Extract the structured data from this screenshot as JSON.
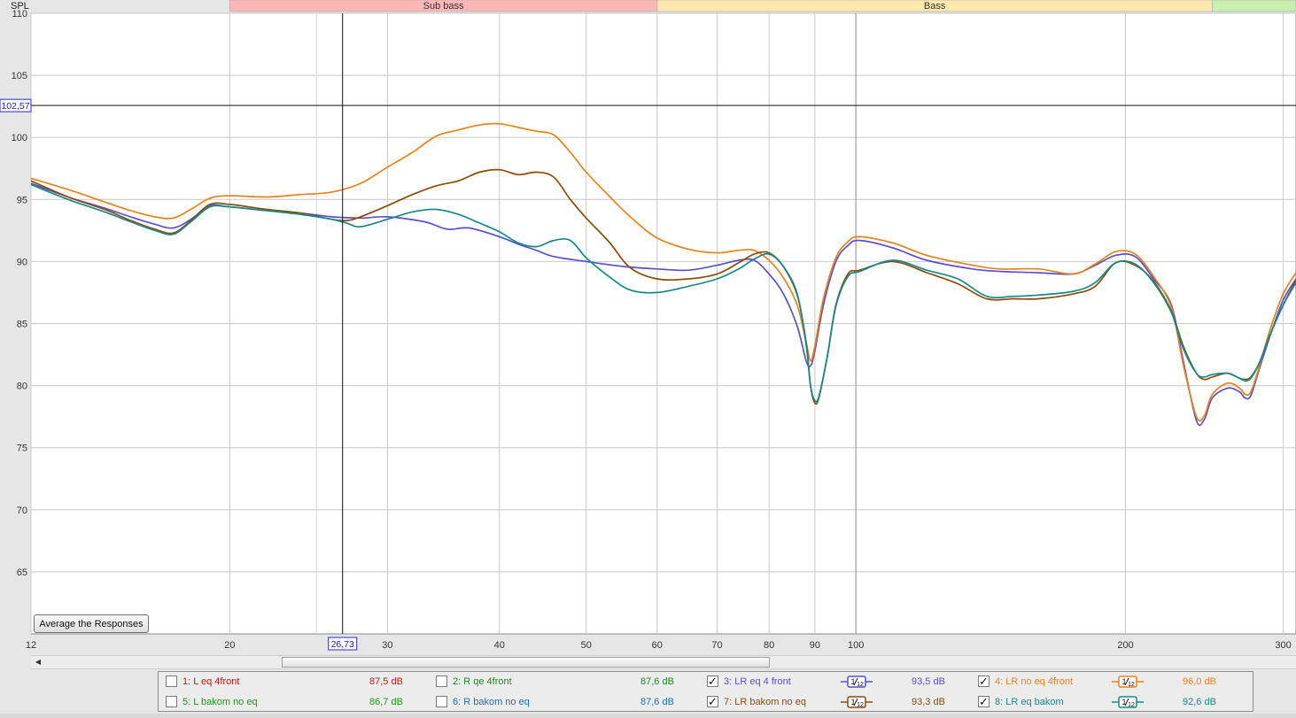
{
  "chart_data": {
    "type": "line",
    "ylabel": "SPL",
    "xscale": "log",
    "xlim": [
      12,
      310
    ],
    "ylim": [
      60,
      110
    ],
    "yticks": [
      65,
      70,
      75,
      80,
      85,
      90,
      95,
      100,
      105,
      110
    ],
    "xticks": [
      12,
      20,
      30,
      40,
      50,
      60,
      70,
      80,
      90,
      100,
      200,
      300
    ],
    "minor_xticks": [
      25
    ],
    "bands": [
      {
        "label": "Sub bass",
        "from": 20,
        "to": 60,
        "color": "#ffb6b6"
      },
      {
        "label": "Bass",
        "from": 60,
        "to": 250,
        "color": "#ffe8ad"
      },
      {
        "label": "",
        "from": 250,
        "to": 310,
        "color": "#c8eeb0"
      }
    ],
    "cursor": {
      "x_label": "26,73",
      "y_label": "102,57",
      "x": 26.73,
      "y": 102.57
    },
    "series": [
      {
        "name": "3: LR eq 4 front",
        "color": "#5a4fd0",
        "points": [
          [
            12,
            96.3
          ],
          [
            13.2,
            95.2
          ],
          [
            14.5,
            94.3
          ],
          [
            15.5,
            93.6
          ],
          [
            16.5,
            93.0
          ],
          [
            17.3,
            92.7
          ],
          [
            18.1,
            93.4
          ],
          [
            19.0,
            94.5
          ],
          [
            20,
            94.4
          ],
          [
            22,
            94.1
          ],
          [
            24,
            93.9
          ],
          [
            26,
            93.6
          ],
          [
            28,
            93.5
          ],
          [
            30,
            93.6
          ],
          [
            33,
            93.2
          ],
          [
            35,
            92.6
          ],
          [
            37,
            92.7
          ],
          [
            40,
            92.0
          ],
          [
            42,
            91.4
          ],
          [
            44,
            90.9
          ],
          [
            46,
            90.4
          ],
          [
            50,
            90.0
          ],
          [
            55,
            89.6
          ],
          [
            60,
            89.4
          ],
          [
            65,
            89.3
          ],
          [
            70,
            89.7
          ],
          [
            74,
            90.1
          ],
          [
            77,
            90.1
          ],
          [
            80,
            89.0
          ],
          [
            83,
            87.4
          ],
          [
            86,
            84.8
          ],
          [
            88,
            82.0
          ],
          [
            89,
            81.6
          ],
          [
            90,
            82.8
          ],
          [
            92,
            86.5
          ],
          [
            95,
            90.0
          ],
          [
            98,
            91.3
          ],
          [
            101,
            91.7
          ],
          [
            110,
            91.1
          ],
          [
            120,
            90.1
          ],
          [
            135,
            89.4
          ],
          [
            145,
            89.2
          ],
          [
            160,
            89.1
          ],
          [
            175,
            89.0
          ],
          [
            185,
            89.7
          ],
          [
            195,
            90.5
          ],
          [
            205,
            90.4
          ],
          [
            215,
            88.6
          ],
          [
            225,
            86.5
          ],
          [
            232,
            82.0
          ],
          [
            240,
            77.2
          ],
          [
            245,
            77.3
          ],
          [
            250,
            79.0
          ],
          [
            260,
            79.8
          ],
          [
            268,
            79.5
          ],
          [
            272,
            79.0
          ],
          [
            276,
            79.2
          ],
          [
            282,
            81.3
          ],
          [
            290,
            84.0
          ],
          [
            300,
            86.9
          ],
          [
            310,
            88.6
          ]
        ]
      },
      {
        "name": "4: LR no eq 4front",
        "color": "#e8821c",
        "points": [
          [
            12,
            96.7
          ],
          [
            13.2,
            95.8
          ],
          [
            14.5,
            94.8
          ],
          [
            15.5,
            94.1
          ],
          [
            16.5,
            93.6
          ],
          [
            17.3,
            93.5
          ],
          [
            18.1,
            94.2
          ],
          [
            19.0,
            95.1
          ],
          [
            20,
            95.3
          ],
          [
            22,
            95.2
          ],
          [
            24,
            95.4
          ],
          [
            26,
            95.6
          ],
          [
            28,
            96.3
          ],
          [
            30,
            97.6
          ],
          [
            32,
            98.8
          ],
          [
            34,
            100.1
          ],
          [
            36,
            100.6
          ],
          [
            38,
            101.0
          ],
          [
            40,
            101.1
          ],
          [
            42,
            100.8
          ],
          [
            44,
            100.5
          ],
          [
            46,
            100.2
          ],
          [
            48,
            98.8
          ],
          [
            50,
            97.2
          ],
          [
            53,
            95.3
          ],
          [
            56,
            93.6
          ],
          [
            60,
            91.9
          ],
          [
            65,
            91.0
          ],
          [
            70,
            90.7
          ],
          [
            74,
            90.9
          ],
          [
            77,
            90.9
          ],
          [
            80,
            90.1
          ],
          [
            83,
            88.7
          ],
          [
            86,
            86.5
          ],
          [
            88,
            83.5
          ],
          [
            89,
            82.0
          ],
          [
            90,
            83.2
          ],
          [
            92,
            87.0
          ],
          [
            95,
            90.3
          ],
          [
            98,
            91.6
          ],
          [
            101,
            92.0
          ],
          [
            110,
            91.5
          ],
          [
            120,
            90.5
          ],
          [
            135,
            89.7
          ],
          [
            145,
            89.4
          ],
          [
            160,
            89.4
          ],
          [
            175,
            89.0
          ],
          [
            185,
            89.8
          ],
          [
            195,
            90.8
          ],
          [
            205,
            90.6
          ],
          [
            215,
            88.8
          ],
          [
            225,
            86.3
          ],
          [
            232,
            81.7
          ],
          [
            240,
            77.5
          ],
          [
            245,
            77.6
          ],
          [
            250,
            79.3
          ],
          [
            260,
            80.2
          ],
          [
            268,
            79.8
          ],
          [
            272,
            79.3
          ],
          [
            276,
            79.5
          ],
          [
            282,
            81.5
          ],
          [
            290,
            84.5
          ],
          [
            300,
            87.4
          ],
          [
            310,
            89.1
          ]
        ]
      },
      {
        "name": "7: LR bakom no eq",
        "color": "#8a4c08",
        "points": [
          [
            12,
            96.5
          ],
          [
            13.2,
            95.2
          ],
          [
            14.5,
            94.2
          ],
          [
            15.5,
            93.3
          ],
          [
            16.5,
            92.6
          ],
          [
            17.3,
            92.3
          ],
          [
            18.1,
            93.3
          ],
          [
            19.0,
            94.6
          ],
          [
            20,
            94.6
          ],
          [
            22,
            94.2
          ],
          [
            24,
            93.9
          ],
          [
            26,
            93.4
          ],
          [
            27,
            93.3
          ],
          [
            28,
            93.6
          ],
          [
            30,
            94.5
          ],
          [
            32,
            95.4
          ],
          [
            34,
            96.1
          ],
          [
            36,
            96.5
          ],
          [
            38,
            97.2
          ],
          [
            40,
            97.4
          ],
          [
            42,
            97.0
          ],
          [
            44,
            97.2
          ],
          [
            46,
            96.8
          ],
          [
            48,
            95.0
          ],
          [
            50,
            93.5
          ],
          [
            53,
            91.6
          ],
          [
            56,
            89.5
          ],
          [
            60,
            88.6
          ],
          [
            65,
            88.6
          ],
          [
            70,
            89.0
          ],
          [
            74,
            89.9
          ],
          [
            77,
            90.6
          ],
          [
            80,
            90.7
          ],
          [
            83,
            89.6
          ],
          [
            86,
            87.3
          ],
          [
            88,
            83.5
          ],
          [
            89,
            80.0
          ],
          [
            90,
            78.6
          ],
          [
            91,
            79.1
          ],
          [
            93,
            82.5
          ],
          [
            95,
            86.5
          ],
          [
            98,
            89.0
          ],
          [
            101,
            89.3
          ],
          [
            110,
            90.0
          ],
          [
            120,
            89.1
          ],
          [
            130,
            88.2
          ],
          [
            140,
            87.0
          ],
          [
            150,
            87.0
          ],
          [
            160,
            87.0
          ],
          [
            175,
            87.4
          ],
          [
            185,
            88.0
          ],
          [
            195,
            89.9
          ],
          [
            205,
            89.7
          ],
          [
            215,
            88.4
          ],
          [
            225,
            86.0
          ],
          [
            232,
            83.2
          ],
          [
            240,
            81.0
          ],
          [
            245,
            80.5
          ],
          [
            250,
            80.7
          ],
          [
            260,
            81.0
          ],
          [
            268,
            80.6
          ],
          [
            272,
            80.5
          ],
          [
            276,
            80.7
          ],
          [
            282,
            81.8
          ],
          [
            290,
            84.1
          ],
          [
            300,
            86.5
          ],
          [
            310,
            88.5
          ]
        ]
      },
      {
        "name": "8: LR eq bakom",
        "color": "#178888",
        "points": [
          [
            12,
            96.2
          ],
          [
            13.2,
            95.0
          ],
          [
            14.5,
            94.0
          ],
          [
            15.5,
            93.2
          ],
          [
            16.5,
            92.5
          ],
          [
            17.3,
            92.2
          ],
          [
            18.1,
            93.2
          ],
          [
            19.0,
            94.4
          ],
          [
            20,
            94.4
          ],
          [
            22,
            94.1
          ],
          [
            24,
            93.8
          ],
          [
            26,
            93.4
          ],
          [
            27,
            93.1
          ],
          [
            28,
            92.8
          ],
          [
            30,
            93.4
          ],
          [
            32,
            94.0
          ],
          [
            34,
            94.2
          ],
          [
            36,
            93.8
          ],
          [
            38,
            93.1
          ],
          [
            40,
            92.4
          ],
          [
            42,
            91.5
          ],
          [
            44,
            91.2
          ],
          [
            46,
            91.7
          ],
          [
            48,
            91.7
          ],
          [
            50,
            90.3
          ],
          [
            53,
            88.8
          ],
          [
            56,
            87.7
          ],
          [
            60,
            87.5
          ],
          [
            65,
            88.0
          ],
          [
            70,
            88.6
          ],
          [
            74,
            89.4
          ],
          [
            77,
            90.2
          ],
          [
            80,
            90.6
          ],
          [
            83,
            89.6
          ],
          [
            86,
            87.4
          ],
          [
            88,
            83.3
          ],
          [
            89,
            80.0
          ],
          [
            90,
            78.8
          ],
          [
            91,
            79.2
          ],
          [
            93,
            82.5
          ],
          [
            95,
            86.4
          ],
          [
            98,
            88.8
          ],
          [
            101,
            89.2
          ],
          [
            110,
            90.1
          ],
          [
            120,
            89.3
          ],
          [
            130,
            88.6
          ],
          [
            140,
            87.2
          ],
          [
            150,
            87.2
          ],
          [
            160,
            87.3
          ],
          [
            175,
            87.6
          ],
          [
            185,
            88.3
          ],
          [
            195,
            89.9
          ],
          [
            205,
            89.8
          ],
          [
            215,
            88.3
          ],
          [
            225,
            85.9
          ],
          [
            232,
            83.0
          ],
          [
            240,
            81.0
          ],
          [
            245,
            80.7
          ],
          [
            250,
            80.9
          ],
          [
            260,
            81.0
          ],
          [
            268,
            80.6
          ],
          [
            272,
            80.4
          ],
          [
            276,
            80.6
          ],
          [
            282,
            81.8
          ],
          [
            290,
            84.1
          ],
          [
            300,
            86.5
          ],
          [
            310,
            88.3
          ]
        ]
      }
    ]
  },
  "ui": {
    "average_button": "Average the Responses",
    "scroll_left": "◀",
    "check_mark": "✓"
  },
  "legend": [
    {
      "label": "1: L eq 4front",
      "spl": "87,5 dB",
      "checked": false,
      "color": "#c01818",
      "smoothing": ""
    },
    {
      "label": "2: R qe 4front",
      "spl": "87,6 dB",
      "checked": false,
      "color": "#1a8a1a",
      "smoothing": ""
    },
    {
      "label": "3: LR eq 4 front",
      "spl": "93,5 dB",
      "checked": true,
      "color": "#5a4fd0",
      "smoothing": "1/12"
    },
    {
      "label": "4: LR no eq 4front",
      "spl": "96,0 dB",
      "checked": true,
      "color": "#e8821c",
      "smoothing": "1/12"
    },
    {
      "label": "5: L bakom no eq",
      "spl": "86,7 dB",
      "checked": false,
      "color": "#1a9a1a",
      "smoothing": ""
    },
    {
      "label": "6: R bakom no eq",
      "spl": "87,6 dB",
      "checked": false,
      "color": "#1a6fb5",
      "smoothing": ""
    },
    {
      "label": "7: LR bakom no eq",
      "spl": "93,3 dB",
      "checked": true,
      "color": "#8a4c08",
      "smoothing": "1/12"
    },
    {
      "label": "8: LR eq bakom",
      "spl": "92,6 dB",
      "checked": true,
      "color": "#178888",
      "smoothing": "1/12"
    }
  ]
}
